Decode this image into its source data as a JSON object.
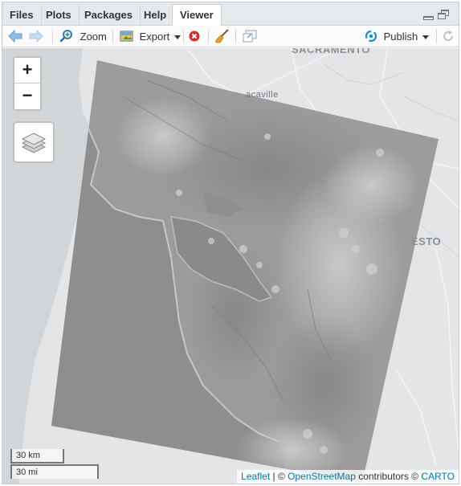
{
  "tabs": [
    {
      "label": "Files"
    },
    {
      "label": "Plots"
    },
    {
      "label": "Packages"
    },
    {
      "label": "Help"
    },
    {
      "label": "Viewer"
    }
  ],
  "active_tab": "Viewer",
  "toolbar": {
    "zoom_label": "Zoom",
    "export_label": "Export",
    "publish_label": "Publish"
  },
  "map": {
    "city_labels": [
      "SACRAMENTO",
      "acaville",
      "ESTO"
    ],
    "zoom_in": "+",
    "zoom_out": "−",
    "scale_km": "30 km",
    "scale_mi": "30 mi",
    "attribution": {
      "leaflet": "Leaflet",
      "sep1": " | © ",
      "osm": "OpenStreetMap",
      "mid": " contributors © ",
      "carto": "CARTO"
    }
  },
  "colors": {
    "accent_blue": "#0078a8",
    "publish_blue": "#1a8ec4",
    "stop_red": "#d0312d"
  },
  "icons": [
    "back-arrow-icon",
    "forward-arrow-icon",
    "zoom-icon",
    "export-icon",
    "stop-icon",
    "broom-icon",
    "popout-icon",
    "publish-icon",
    "refresh-icon",
    "layers-icon"
  ]
}
